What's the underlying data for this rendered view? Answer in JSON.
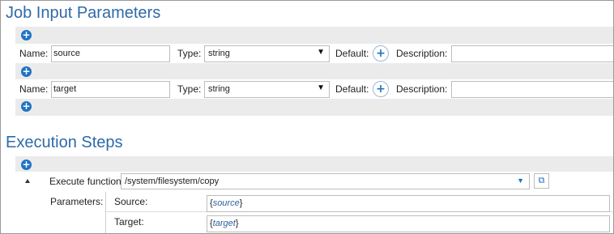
{
  "job_input": {
    "title": "Job Input Parameters",
    "name_label": "Name:",
    "type_label": "Type:",
    "default_label": "Default:",
    "description_label": "Description:",
    "params": [
      {
        "name": "source",
        "type": "string",
        "description": ""
      },
      {
        "name": "target",
        "type": "string",
        "description": ""
      }
    ]
  },
  "execution": {
    "title": "Execution Steps",
    "execute_label": "Execute function",
    "function_path": "/system/filesystem/copy",
    "parameters_label": "Parameters:",
    "args": [
      {
        "label": "Source:",
        "open": "{",
        "value": "source",
        "close": "}"
      },
      {
        "label": "Target:",
        "open": "{",
        "value": "target",
        "close": "}"
      }
    ]
  },
  "icons": {
    "plus": "+",
    "dropdown": "▼",
    "open_external": "⧉"
  },
  "colors": {
    "title": "#2e6aa8",
    "accent": "#1f73c4",
    "panel": "#ebebeb"
  }
}
